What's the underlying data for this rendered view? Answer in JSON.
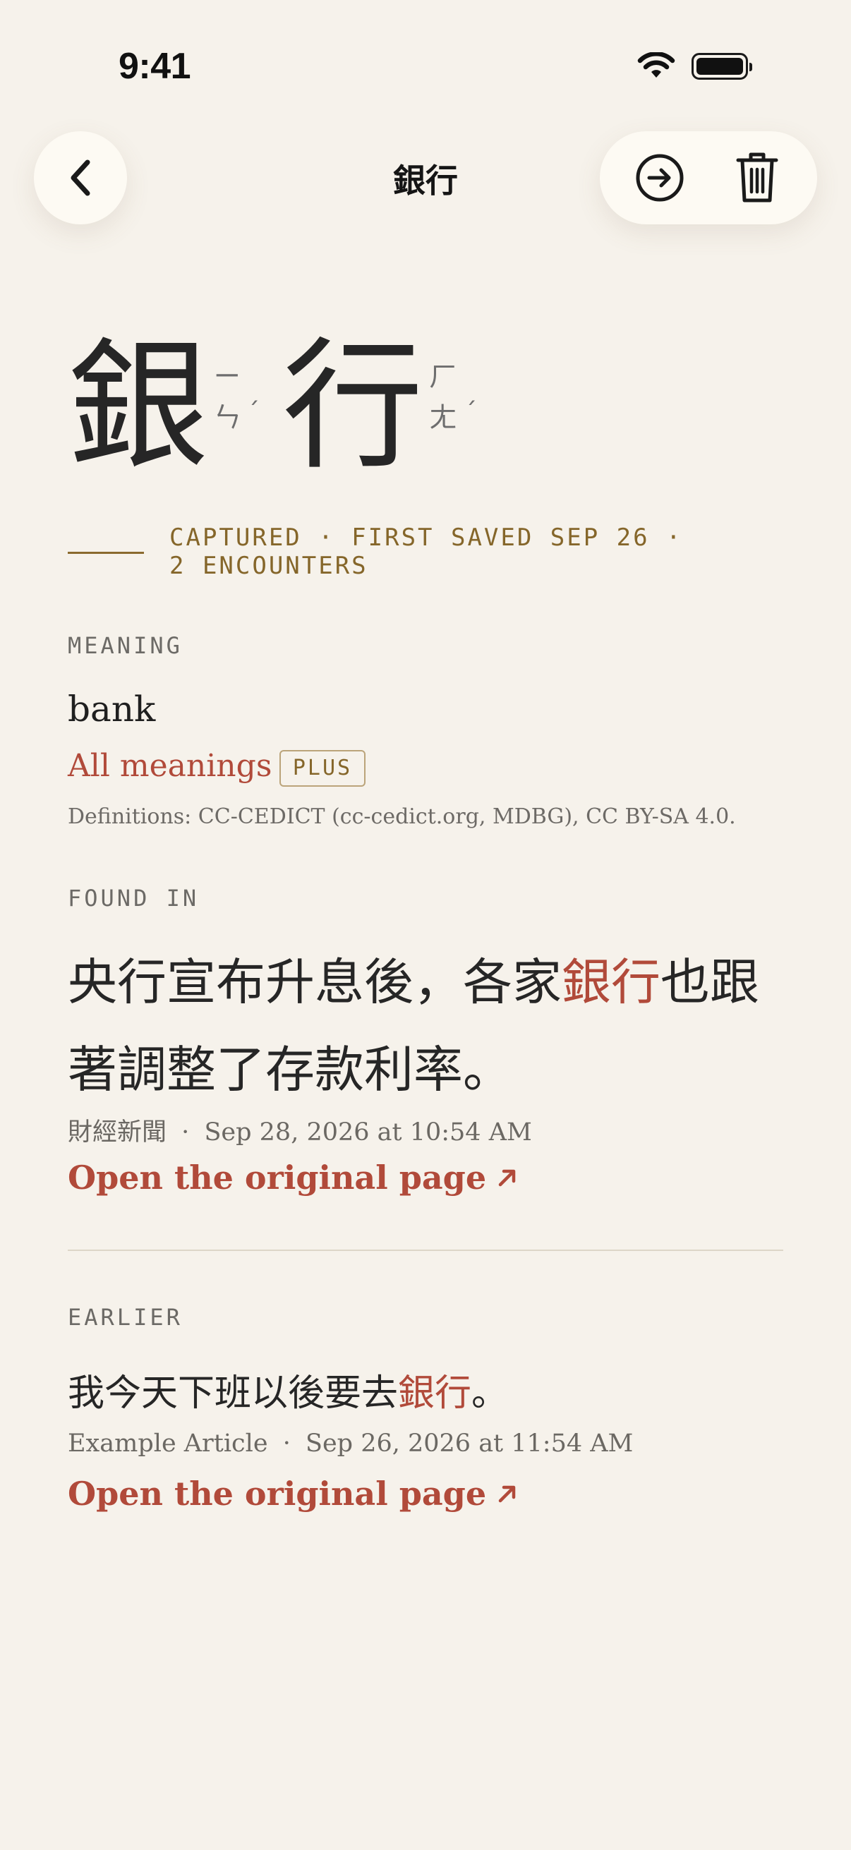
{
  "status_bar": {
    "time": "9:41"
  },
  "nav": {
    "title": "銀行"
  },
  "headword": {
    "chars": [
      {
        "hanzi": "銀",
        "zhuyin": [
          "ㄧ",
          "ㄣ"
        ],
        "tone": "ˊ"
      },
      {
        "hanzi": "行",
        "zhuyin": [
          "ㄏ",
          "ㄤ"
        ],
        "tone": "ˊ"
      }
    ]
  },
  "captured": {
    "line1": "CAPTURED · FIRST SAVED SEP 26 ·",
    "line2": "2 ENCOUNTERS"
  },
  "meaning": {
    "label": "MEANING",
    "gloss": "bank",
    "all_meanings": "All meanings",
    "badge": "PLUS",
    "definitions": "Definitions: CC-CEDICT (cc-cedict.org, MDBG), CC BY-SA 4.0."
  },
  "found_in": {
    "label": "FOUND IN",
    "sentence_before": "央行宣布升息後，各家",
    "sentence_highlight": "銀行",
    "sentence_after": "也跟著調整了存款利率。",
    "source": "財經新聞",
    "separator": "·",
    "date": "Sep 28, 2026 at 10:54 AM",
    "link": "Open the original page"
  },
  "earlier": {
    "label": "EARLIER",
    "sentence_before": "我今天下班以後要去",
    "sentence_highlight": "銀行",
    "sentence_after": "。",
    "source": "Example Article",
    "separator": "·",
    "date": "Sep 26, 2026 at 11:54 AM",
    "link": "Open the original page"
  },
  "colors": {
    "accent": "#b14a3a",
    "gold": "#85662a",
    "background": "#f6f2eb"
  },
  "icons": [
    "chevron-left-icon",
    "arrow-circle-right-icon",
    "trash-icon",
    "wifi-icon",
    "battery-icon",
    "arrow-up-right-icon"
  ]
}
